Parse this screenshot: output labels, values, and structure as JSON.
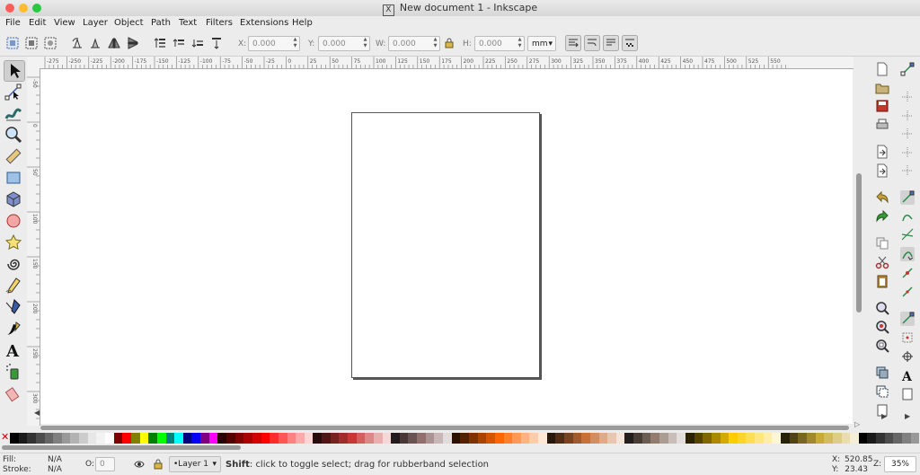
{
  "window": {
    "title": "New document 1 - Inkscape",
    "title_x_glyph": "X",
    "traffic_lights": {
      "close": "#fd5f57",
      "minimize": "#febc2e",
      "maximize": "#28c840"
    }
  },
  "menubar": {
    "items": [
      "File",
      "Edit",
      "View",
      "Layer",
      "Object",
      "Path",
      "Text",
      "Filters",
      "Extensions",
      "Help"
    ]
  },
  "controls": {
    "x_label": "X:",
    "x_value": "0.000",
    "y_label": "Y:",
    "y_value": "0.000",
    "w_label": "W:",
    "w_value": "0.000",
    "h_label": "H:",
    "h_value": "0.000",
    "unit": "mm"
  },
  "ruler": {
    "h_labels": [
      "-275",
      "-250",
      "-225",
      "-200",
      "-175",
      "-150",
      "-125",
      "-100",
      "-75",
      "-50",
      "-25",
      "0",
      "25",
      "50",
      "75",
      "100",
      "125",
      "150",
      "175",
      "200",
      "225",
      "250",
      "275",
      "300",
      "325",
      "350",
      "375",
      "400",
      "425",
      "450",
      "475",
      "500",
      "525",
      "550"
    ],
    "v_labels": [
      "-50",
      "0",
      "50",
      "100",
      "150",
      "200",
      "250",
      "300"
    ]
  },
  "tools": [
    "selector-tool",
    "node-tool",
    "tweak-tool",
    "zoom-tool",
    "measure-tool",
    "rectangle-tool",
    "3d-box-tool",
    "ellipse-tool",
    "star-tool",
    "spiral-tool",
    "pencil-tool",
    "pen-tool",
    "calligraphy-tool",
    "text-tool",
    "spray-tool",
    "eraser-tool"
  ],
  "palette": {
    "colors": [
      "#000000",
      "#1a1a1a",
      "#333333",
      "#4d4d4d",
      "#666666",
      "#808080",
      "#999999",
      "#b3b3b3",
      "#cccccc",
      "#e6e6e6",
      "#f2f2f2",
      "#ffffff",
      "#800000",
      "#ff0000",
      "#808000",
      "#ffff00",
      "#008000",
      "#00ff00",
      "#008080",
      "#00ffff",
      "#000080",
      "#0000ff",
      "#800080",
      "#ff00ff",
      "#2b0000",
      "#550000",
      "#800000",
      "#aa0000",
      "#d40000",
      "#ff0000",
      "#ff2a2a",
      "#ff5555",
      "#ff8080",
      "#ffaaaa",
      "#ffd5d5",
      "#280b0b",
      "#501616",
      "#782121",
      "#a02c2c",
      "#c83737",
      "#d35f5f",
      "#de8787",
      "#e9afaf",
      "#f4d7d7",
      "#241c1c",
      "#483737",
      "#6c5353",
      "#916f6f",
      "#ac9393",
      "#c8b7b7",
      "#e3dbdb",
      "#2b1100",
      "#552200",
      "#803300",
      "#aa4400",
      "#d45500",
      "#ff6600",
      "#ff7f2a",
      "#ff9955",
      "#ffb380",
      "#ffccaa",
      "#ffe6d5",
      "#28170b",
      "#502d16",
      "#784421",
      "#a05a2c",
      "#c87137",
      "#d38d5f",
      "#deaa87",
      "#e9c6af",
      "#f4e3d7",
      "#241f1c",
      "#483e37",
      "#6c5d53",
      "#917c6f",
      "#ac9d93",
      "#c8beb7",
      "#e3dedb",
      "#2b2200",
      "#554400",
      "#806600",
      "#aa8800",
      "#d4aa00",
      "#ffcc00",
      "#ffd42a",
      "#ffdd55",
      "#ffe680",
      "#ffeeaa",
      "#fff6d5",
      "#28220b",
      "#504416",
      "#786721",
      "#a0892c",
      "#c8ab37",
      "#d3bc5f",
      "#decd87",
      "#e9ddaf",
      "#f4eed7",
      "#000000",
      "#1a1a1a",
      "#333333",
      "#4d4d4d",
      "#666666",
      "#808080",
      "#999999"
    ]
  },
  "status": {
    "fill_label": "Fill:",
    "fill_value": "N/A",
    "stroke_label": "Stroke:",
    "stroke_value": "N/A",
    "opacity_label": "O:",
    "opacity_value": "0",
    "layer": "•Layer 1",
    "message_bold": "Shift",
    "message": ": click to toggle select; drag for rubberband selection",
    "x_label": "X:",
    "x_value": "520.85",
    "y_label": "Y:",
    "y_value": "23.43",
    "zoom_label": "Z:",
    "zoom_value": "35%"
  }
}
